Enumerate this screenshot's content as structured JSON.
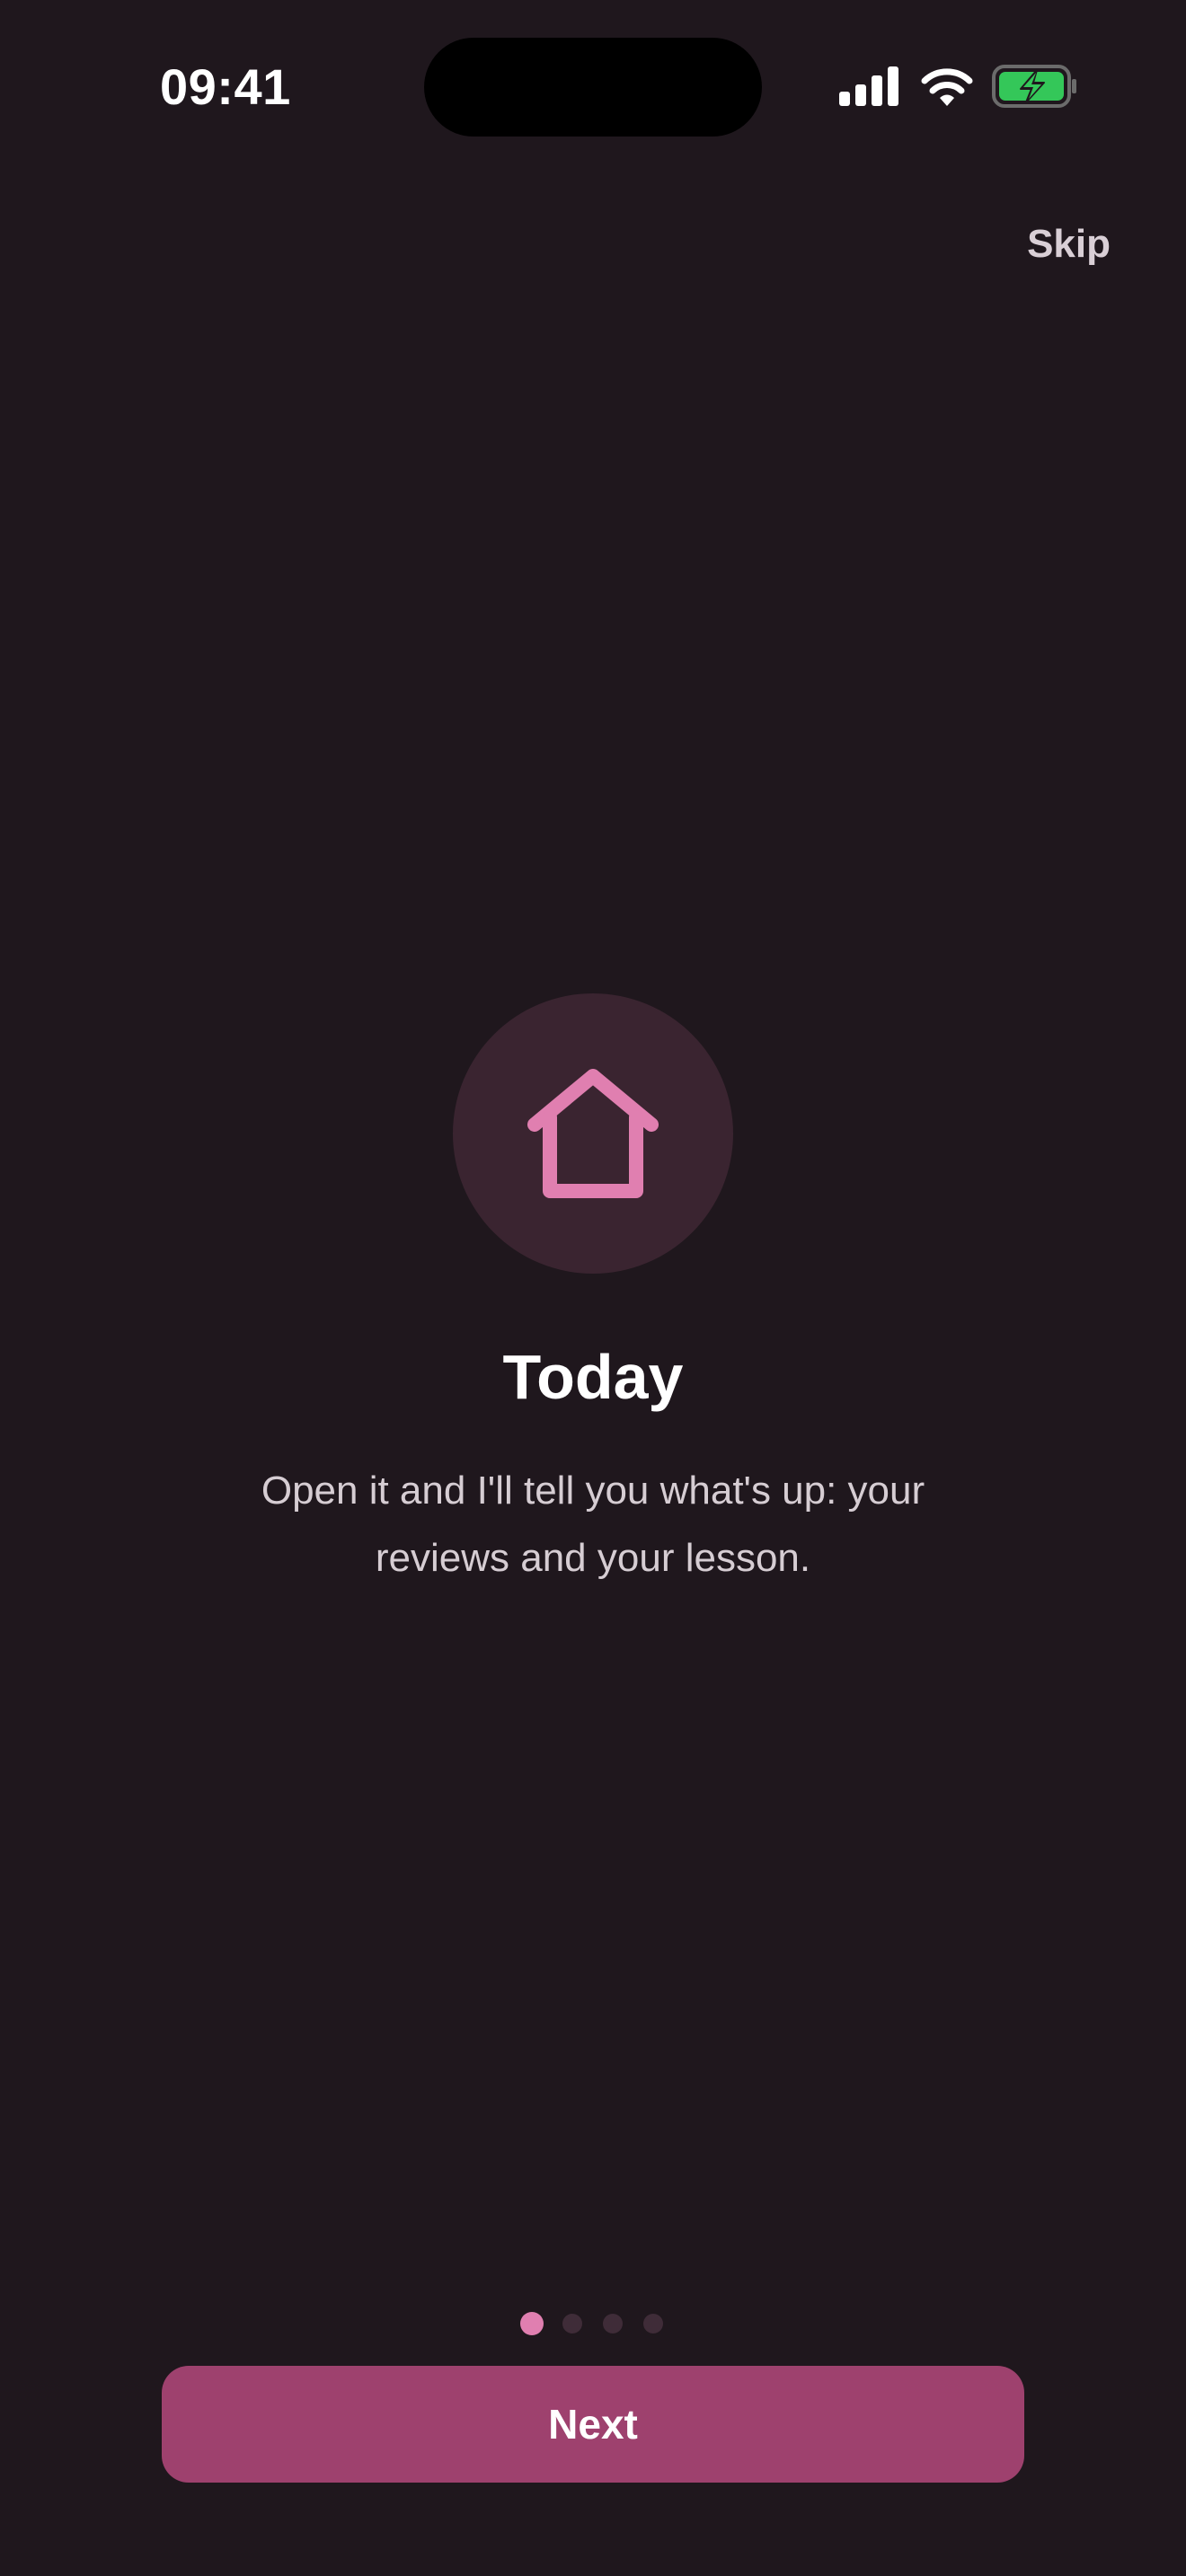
{
  "status_bar": {
    "time": "09:41"
  },
  "header": {
    "skip_label": "Skip"
  },
  "onboarding": {
    "icon": "house-icon",
    "title": "Today",
    "description": "Open it and I'll tell you what's up: your reviews and your lesson.",
    "page_count": 4,
    "current_page": 1
  },
  "footer": {
    "next_label": "Next"
  },
  "colors": {
    "background": "#1f171d",
    "accent": "#e07fb0",
    "button": "#9e416e",
    "icon_circle": "#3a2430",
    "battery_green": "#34c759"
  }
}
